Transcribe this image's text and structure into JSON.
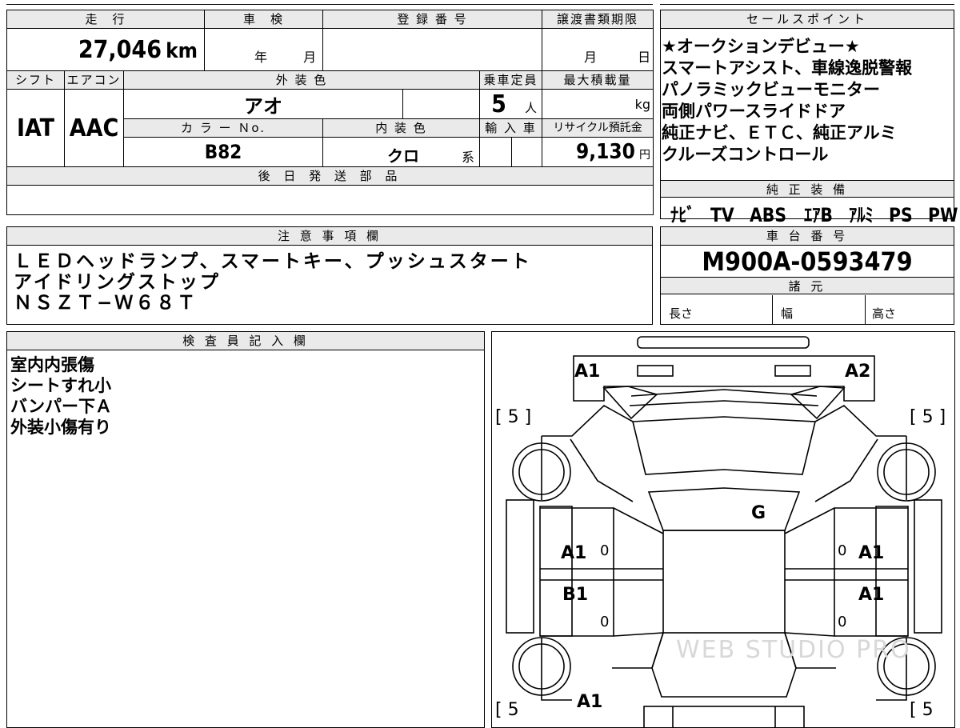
{
  "vehicle": {
    "labels": {
      "mileage": "走　行",
      "inspection": "車　検",
      "registration": "登 録 番 号",
      "transfer_deadline": "譲渡書類期限",
      "shift": "シフト",
      "aircon": "エアコン",
      "exterior_color": "外 装 色",
      "capacity": "乗車定員",
      "max_load": "最大積載量",
      "color_no": "カ ラ ー Ｎo.",
      "interior_color": "内 装 色",
      "import": "輸 入 車",
      "recycle_fee": "リサイクル預託金",
      "later_parts": "後 日 発 送 部 品"
    },
    "mileage": "27,046",
    "mileage_unit": "km",
    "inspection_year": "年",
    "inspection_month": "月",
    "transfer_month": "月",
    "transfer_day": "日",
    "shift": "IAT",
    "aircon": "AAC",
    "exterior_color": "アオ",
    "capacity": "5",
    "capacity_unit": "人",
    "max_load_unit": "kg",
    "color_no": "B82",
    "interior_color": "クロ",
    "interior_suffix": "系",
    "recycle_fee": "9,130",
    "recycle_unit": "円"
  },
  "sales_points": {
    "title": "セールスポイント",
    "lines": [
      "★オークションデビュー★",
      "スマートアシスト、車線逸脱警報",
      "パノラミックビューモニター",
      "両側パワースライドドア",
      "純正ナビ、ＥＴＣ、純正アルミ",
      "クルーズコントロール"
    ]
  },
  "genuine_equipment": {
    "title": "純 正 装 備",
    "items": [
      "ﾅﾋﾞ",
      "TV",
      "ABS",
      "ｴｱB",
      "ｱﾙﾐ",
      "PS",
      "PW"
    ]
  },
  "notes": {
    "title": "注 意 事 項 欄",
    "lines": [
      "ＬＥＤヘッドランプ、スマートキー、プッシュスタート",
      "アイドリングストップ",
      "ＮＳＺＴ−Ｗ６８Ｔ"
    ]
  },
  "chassis": {
    "title": "車 台 番 号",
    "number": "M900A-0593479",
    "specs_title": "諸 元",
    "length": "長さ",
    "width": "幅",
    "height": "高さ"
  },
  "inspector": {
    "title": "検 査 員 記 入 欄",
    "lines": [
      "室内内張傷",
      "シートすれ小",
      "バンパー下Ａ",
      "外装小傷有り"
    ]
  },
  "diagram": {
    "marks": {
      "front_left": "A1",
      "front_right": "A2",
      "roof": "G",
      "front_door_left": "A1",
      "front_door_right": "A1",
      "rear_door_left": "B1",
      "rear_door_right": "A1",
      "rear": "A1"
    },
    "tire_left_front": "[ 5 ]",
    "tire_right_front": "[ 5 ]",
    "tire_left_rear": "[ 5",
    "tire_right_rear": "[ 5",
    "zero": "0",
    "watermark": "WEB STUDIO PRO"
  }
}
